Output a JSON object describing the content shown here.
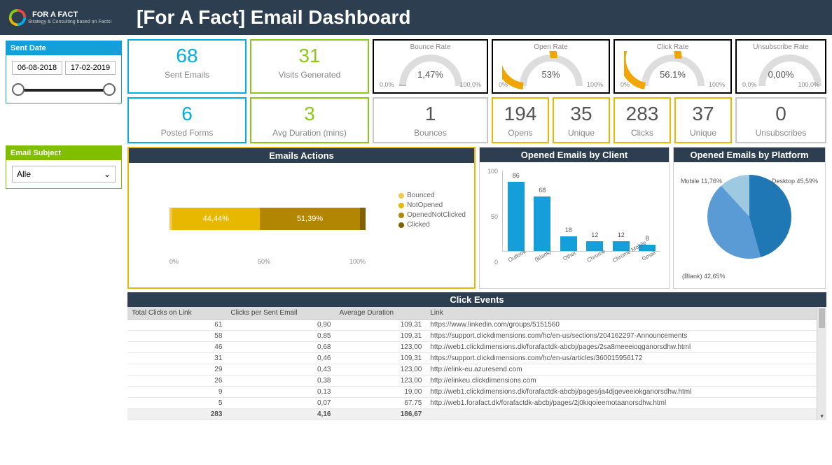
{
  "brand": {
    "name": "FOR A FACT",
    "tagline": "Strategy & Consulting based on Facts!"
  },
  "title": "[For A Fact] Email Dashboard",
  "filters": {
    "sent_date": {
      "label": "Sent Date",
      "from": "06-08-2018",
      "to": "17-02-2019"
    },
    "email_subject": {
      "label": "Email Subject",
      "value": "Alle"
    }
  },
  "metrics": {
    "sent_emails": {
      "value": "68",
      "label": "Sent Emails"
    },
    "visits": {
      "value": "31",
      "label": "Visits Generated"
    },
    "posted_forms": {
      "value": "6",
      "label": "Posted Forms"
    },
    "avg_duration": {
      "value": "3",
      "label": "Avg Duration (mins)"
    },
    "bounces": {
      "value": "1",
      "label": "Bounces"
    },
    "opens": {
      "value": "194",
      "label": "Opens"
    },
    "opens_unique": {
      "value": "35",
      "label": "Unique"
    },
    "clicks": {
      "value": "283",
      "label": "Clicks"
    },
    "clicks_unique": {
      "value": "37",
      "label": "Unique"
    },
    "unsubs": {
      "value": "0",
      "label": "Unsubscribes"
    }
  },
  "gauges": {
    "bounce_rate": {
      "title": "Bounce Rate",
      "min": "0,0%",
      "max": "100,0%",
      "value": "1,47%",
      "pct": 1.47
    },
    "open_rate": {
      "title": "Open Rate",
      "min": "0%",
      "max": "100%",
      "value": "53%",
      "pct": 53
    },
    "click_rate": {
      "title": "Click Rate",
      "min": "0%",
      "max": "100%",
      "value": "56.1%",
      "pct": 56.1
    },
    "unsub_rate": {
      "title": "Unsubscribe Rate",
      "min": "0,0%",
      "max": "100,0%",
      "value": "0,00%",
      "pct": 0
    }
  },
  "emails_actions": {
    "title": "Emails Actions",
    "legend": [
      "Bounced",
      "NotOpened",
      "OpenedNotClicked",
      "Clicked"
    ],
    "segments": [
      {
        "label": "",
        "pct": 1.47,
        "color": "#f2c94c"
      },
      {
        "label": "44,44%",
        "pct": 44.44,
        "color": "#e6b800"
      },
      {
        "label": "51,39%",
        "pct": 51.39,
        "color": "#b38600"
      },
      {
        "label": "",
        "pct": 2.7,
        "color": "#806000"
      }
    ],
    "axis": [
      "0%",
      "50%",
      "100%"
    ]
  },
  "by_client": {
    "title": "Opened Emails by Client",
    "ymax": 100,
    "yticks": [
      "100",
      "50",
      "0"
    ],
    "bars": [
      {
        "label": "Outlook",
        "value": 86
      },
      {
        "label": "(Blank)",
        "value": 68
      },
      {
        "label": "Other",
        "value": 18
      },
      {
        "label": "Chrome",
        "value": 12
      },
      {
        "label": "Chrome Mobile",
        "value": 12
      },
      {
        "label": "Gmail",
        "value": 8
      }
    ]
  },
  "by_platform": {
    "title": "Opened Emails by Platform",
    "slices": [
      {
        "label": "Desktop 45,59%",
        "pct": 45.59,
        "color": "#1f77b4"
      },
      {
        "label": "(Blank) 42,65%",
        "pct": 42.65,
        "color": "#5b9bd5"
      },
      {
        "label": "Mobile 11,76%",
        "pct": 11.76,
        "color": "#9ecae1"
      }
    ]
  },
  "click_events": {
    "title": "Click Events",
    "columns": [
      "Total Clicks on Link",
      "Clicks per Sent Email",
      "Average Duration",
      "Link"
    ],
    "rows": [
      [
        "61",
        "0,90",
        "109,31",
        "https://www.linkedin.com/groups/5151560"
      ],
      [
        "58",
        "0,85",
        "109,31",
        "https://support.clickdimensions.com/hc/en-us/sections/204162297-Announcements"
      ],
      [
        "46",
        "0,68",
        "123,00",
        "http://web1.clickdimensions.dk/forafactdk-abcbj/pages/2sa8meeeioqganorsdhw.html"
      ],
      [
        "31",
        "0,46",
        "109,31",
        "https://support.clickdimensions.com/hc/en-us/articles/360015956172"
      ],
      [
        "29",
        "0,43",
        "123,00",
        "http://elink-eu.azuresend.com"
      ],
      [
        "26",
        "0,38",
        "123,00",
        "http://elinkeu.clickdimensions.com"
      ],
      [
        "9",
        "0,13",
        "19,00",
        "http://web1.clickdimensions.dk/forafactdk-abcbj/pages/ja4djqeveeiokganorsdhw.html"
      ],
      [
        "5",
        "0,07",
        "67,75",
        "http://web1.forafact.dk/forafactdk-abcbj/pages/2j0kiqoieemotaanorsdhw.html"
      ]
    ],
    "totals": [
      "283",
      "4,16",
      "186,67",
      ""
    ]
  },
  "chart_data": [
    {
      "type": "bar",
      "title": "Opened Emails by Client",
      "categories": [
        "Outlook",
        "(Blank)",
        "Other",
        "Chrome",
        "Chrome Mobile",
        "Gmail"
      ],
      "values": [
        86,
        68,
        18,
        12,
        12,
        8
      ],
      "ylim": [
        0,
        100
      ]
    },
    {
      "type": "pie",
      "title": "Opened Emails by Platform",
      "categories": [
        "Desktop",
        "(Blank)",
        "Mobile"
      ],
      "values": [
        45.59,
        42.65,
        11.76
      ]
    },
    {
      "type": "bar",
      "title": "Emails Actions (stacked %)",
      "categories": [
        "Bounced",
        "NotOpened",
        "OpenedNotClicked",
        "Clicked"
      ],
      "values": [
        1.47,
        44.44,
        51.39,
        2.7
      ],
      "xlim": [
        0,
        100
      ]
    },
    {
      "type": "table",
      "title": "Click Events",
      "columns": [
        "Total Clicks on Link",
        "Clicks per Sent Email",
        "Average Duration",
        "Link"
      ],
      "rows": [
        [
          61,
          0.9,
          109.31,
          "https://www.linkedin.com/groups/5151560"
        ],
        [
          58,
          0.85,
          109.31,
          "https://support.clickdimensions.com/hc/en-us/sections/204162297-Announcements"
        ],
        [
          46,
          0.68,
          123.0,
          "http://web1.clickdimensions.dk/forafactdk-abcbj/pages/2sa8meeeioqganorsdhw.html"
        ],
        [
          31,
          0.46,
          109.31,
          "https://support.clickdimensions.com/hc/en-us/articles/360015956172"
        ],
        [
          29,
          0.43,
          123.0,
          "http://elink-eu.azuresend.com"
        ],
        [
          26,
          0.38,
          123.0,
          "http://elinkeu.clickdimensions.com"
        ],
        [
          9,
          0.13,
          19.0,
          "http://web1.clickdimensions.dk/forafactdk-abcbj/pages/ja4djqeveeiokganorsdhw.html"
        ],
        [
          5,
          0.07,
          67.75,
          "http://web1.forafact.dk/forafactdk-abcbj/pages/2j0kiqoieemotaanorsdhw.html"
        ]
      ],
      "totals": [
        283,
        4.16,
        186.67,
        ""
      ]
    }
  ]
}
